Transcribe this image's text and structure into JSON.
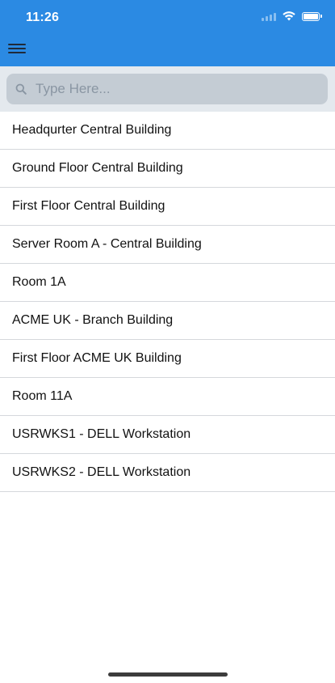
{
  "status_bar": {
    "time": "11:26"
  },
  "header": {
    "menu_icon": "hamburger-menu-icon",
    "background_color": "#2B8AE3"
  },
  "search": {
    "placeholder": "Type Here...",
    "value": "",
    "icon": "search-icon"
  },
  "list": {
    "items": [
      {
        "label": "Headqurter Central Building"
      },
      {
        "label": "Ground Floor Central Building"
      },
      {
        "label": "First Floor Central Building"
      },
      {
        "label": "Server Room A - Central Building"
      },
      {
        "label": "Room 1A"
      },
      {
        "label": "ACME UK - Branch Building"
      },
      {
        "label": "First Floor ACME UK Building"
      },
      {
        "label": "Room 11A"
      },
      {
        "label": "USRWKS1 - DELL Workstation"
      },
      {
        "label": "USRWKS2 - DELL Workstation"
      }
    ]
  }
}
